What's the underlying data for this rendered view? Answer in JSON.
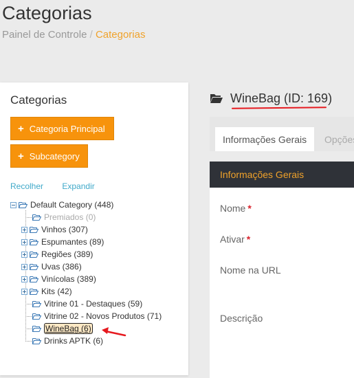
{
  "header": {
    "title": "Categorias",
    "breadcrumb": {
      "home": "Painel de Controle",
      "separator": "/",
      "current": "Categorias"
    }
  },
  "left_panel": {
    "title": "Categorias",
    "buttons": {
      "main": "Categoria Principal",
      "sub": "Subcategory"
    },
    "actions": {
      "collapse": "Recolher",
      "expand": "Expandir"
    },
    "tree": {
      "root": "Default Category (448)",
      "children": [
        {
          "label": "Premiados (0)",
          "toggle": "none",
          "muted": true
        },
        {
          "label": "Vinhos (307)",
          "toggle": "plus"
        },
        {
          "label": "Espumantes (89)",
          "toggle": "plus"
        },
        {
          "label": "Regiões (389)",
          "toggle": "plus"
        },
        {
          "label": "Uvas (386)",
          "toggle": "plus"
        },
        {
          "label": "Vinícolas (389)",
          "toggle": "plus"
        },
        {
          "label": "Kits (42)",
          "toggle": "plus"
        },
        {
          "label": "Vitrine 01 - Destaques (59)",
          "toggle": "none"
        },
        {
          "label": "Vitrine 02 - Novos Produtos (71)",
          "toggle": "none"
        },
        {
          "label": "WineBag (6)",
          "toggle": "none",
          "selected": true
        },
        {
          "label": "Drinks APTK (6)",
          "toggle": "none"
        }
      ]
    }
  },
  "right_panel": {
    "category_title": "WineBag (ID: 169)",
    "tabs": [
      "Informações Gerais",
      "Opções"
    ],
    "form": {
      "section_title": "Informações Gerais",
      "fields": [
        {
          "label": "Nome",
          "required": "*"
        },
        {
          "label": "Ativar",
          "required": "*"
        },
        {
          "label": "Nome na URL"
        },
        {
          "label": "Descrição"
        }
      ]
    }
  },
  "colors": {
    "accent": "#f7930c",
    "link": "#3fa9c9",
    "annotation": "#e6191f"
  }
}
